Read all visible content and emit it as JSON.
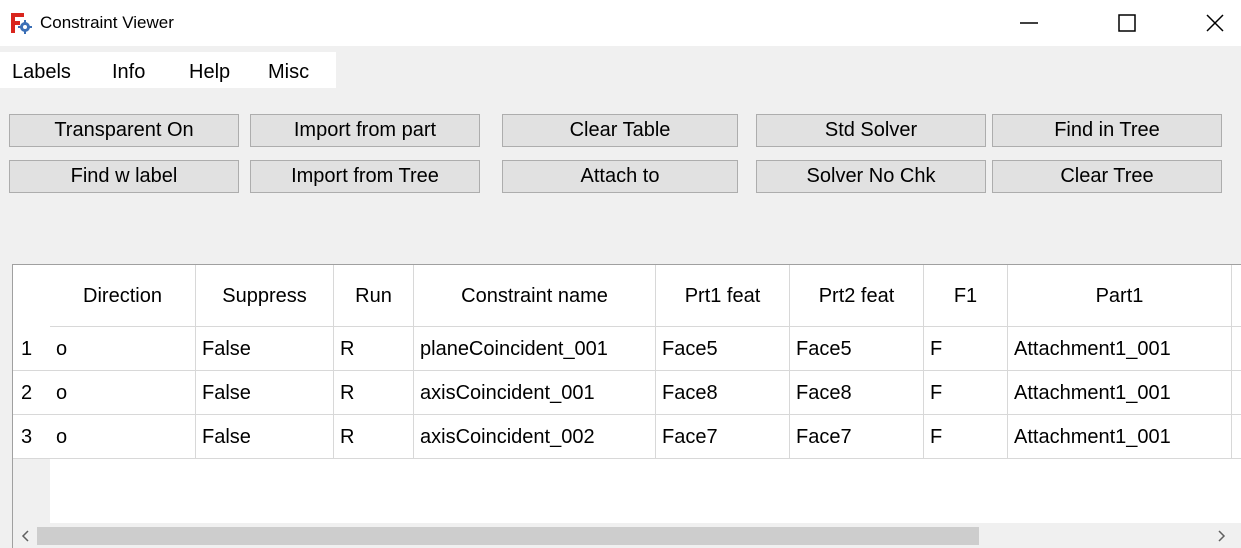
{
  "window": {
    "title": "Constraint Viewer",
    "minimize_icon": "minimize-icon",
    "maximize_icon": "maximize-icon",
    "close_icon": "close-icon"
  },
  "menu": {
    "items": [
      "Labels",
      "Info",
      "Help",
      "Misc"
    ]
  },
  "buttons": {
    "transparent_on": "Transparent On",
    "import_from_part": "Import from part",
    "clear_table": "Clear Table",
    "std_solver": "Std Solver",
    "find_in_tree": "Find in Tree",
    "find_w_label": "Find w label",
    "import_from_tree": "Import from Tree",
    "attach_to": "Attach to",
    "solver_no_chk": "Solver No Chk",
    "clear_tree": "Clear Tree"
  },
  "table": {
    "columns": [
      "Direction",
      "Suppress",
      "Run",
      "Constraint name",
      "Prt1 feat",
      "Prt2 feat",
      "F1",
      "Part1"
    ],
    "rows": [
      {
        "num": "1",
        "cells": [
          "o",
          "False",
          "R",
          "planeCoincident_001",
          "Face5",
          "Face5",
          "F",
          "Attachment1_001"
        ]
      },
      {
        "num": "2",
        "cells": [
          "o",
          "False",
          "R",
          "axisCoincident_001",
          "Face8",
          "Face8",
          "F",
          "Attachment1_001"
        ]
      },
      {
        "num": "3",
        "cells": [
          "o",
          "False",
          "R",
          "axisCoincident_002",
          "Face7",
          "Face7",
          "F",
          "Attachment1_001"
        ]
      }
    ]
  },
  "scrollbar": {
    "left_icon": "scroll-left-icon",
    "right_icon": "scroll-right-icon"
  },
  "colors": {
    "window_bg": "#f0f0f0",
    "button_bg": "#e1e1e1",
    "button_border": "#adadad",
    "app_icon_red": "#d9251d",
    "app_icon_blue": "#3b6fb6"
  }
}
